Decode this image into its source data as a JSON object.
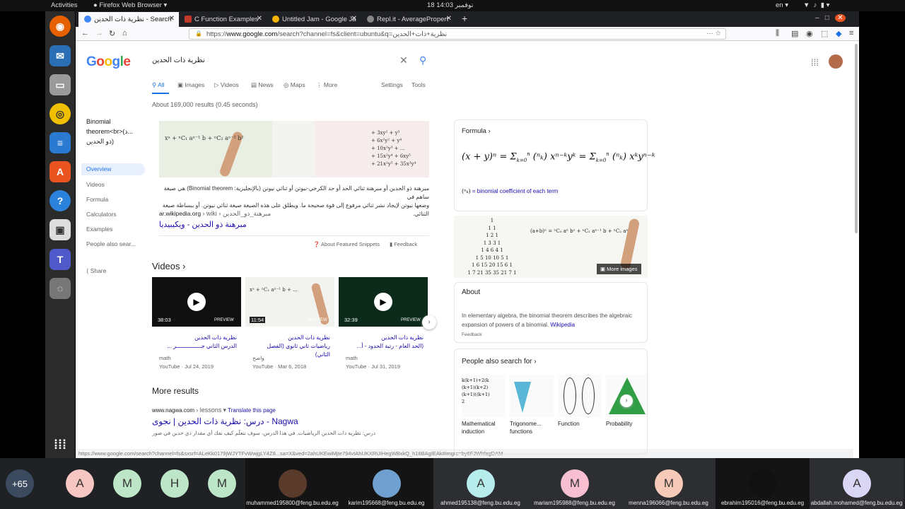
{
  "system": {
    "activities": "Activities",
    "app": "Firefox Web Browser",
    "datetime": "18 نوفمبر  14:03",
    "lang": "en"
  },
  "tabs": [
    {
      "title": "نظرية ذات الحدين - Search"
    },
    {
      "title": "C Function Examples"
    },
    {
      "title": "Untitled Jam - Google Ja"
    },
    {
      "title": "Repl.it - AveragePropert"
    }
  ],
  "url": {
    "prefix": "https://",
    "domain": "www.google.com",
    "path": "/search?channel=fs&client=ubuntu&q=نظرية+ذات+الحدين"
  },
  "search": {
    "logo": "Google",
    "query": "نظرية ذات الحدين"
  },
  "filters": [
    {
      "label": "All",
      "active": true
    },
    {
      "label": "Images"
    },
    {
      "label": "Videos"
    },
    {
      "label": "News"
    },
    {
      "label": "Maps"
    },
    {
      "label": "More"
    }
  ],
  "tools": {
    "settings": "Settings",
    "tools": "Tools"
  },
  "results_count": "About 169,000 results (0.45 seconds)",
  "side_nav": {
    "title": "Binomial theorem<br>(ذ...ذو الحدين)",
    "title1": "Binomial",
    "title2": "theorem<br>(ذ...",
    "title3": "ذو الحدين)",
    "items": [
      "Overview",
      "Videos",
      "Formula",
      "Calculators",
      "Examples",
      "People also sear..."
    ],
    "share": "Share"
  },
  "snippet": {
    "text1": "مبرهنة ذو الحدين أو مبرهنة ثنائي الحد أو حد الكرخي-نيوتن أو ثنائي نيوتن (بالإنجليزية: Binomial theorem) هي صيغة ساهم في",
    "text2": "وضعها نيوتن لإيجاد نشر ثنائي مرفوع إلى قوة صحيحة ما. ويطلق على هذه الصيغة صيغة ثنائي نيوتن. أو ببساطة صيغة الثنائي.",
    "source": "ar.wikipedia.org",
    "crumb": "› wiki › مبرهنة_ذو_الحدين",
    "link": "مبرهنة ذو الحدين - ويكيبيديا",
    "about": "About Featured Snippets",
    "feedback": "Feedback"
  },
  "videos": {
    "heading": "Videos",
    "items": [
      {
        "duration": "38:03",
        "preview": "PREVIEW",
        "title1": "نظرية ذات الحدين",
        "title2": "الدرس الثاني جـــــــــــــــر ...",
        "channel": "math",
        "source": "YouTube",
        "date": "Jul 24, 2019"
      },
      {
        "duration": "11:54",
        "preview": "PREVIEW",
        "title1": "نظرية ذات الحدين",
        "title2": "رياضيات ثاني ثانوي (الفصل الثاني)",
        "channel": "واضح",
        "source": "YouTube",
        "date": "Mar 6, 2018"
      },
      {
        "duration": "32:39",
        "preview": "PREVIEW",
        "title1": "نظرية ذات الحدين",
        "title2": "(الحد العام - رتبة الحدود - أ...",
        "channel": "math",
        "source": "YouTube",
        "date": "Jul 31, 2019"
      }
    ]
  },
  "more_results": {
    "heading": "More results",
    "source": "www.nagwa.com",
    "crumb": "› lessons",
    "translate": "Translate this page",
    "title": "درس: نظرية ذات الحدين | نجوى - Nagwa",
    "snippet": "درس: نظرية ذات الحدين الرياضيات. في هذا الدرس، سوف نتعلَّم كيف نفك أي مقدار ذي حدين في صورة: (أ+ب)^ن."
  },
  "status_url": "https://www.google.com/search?channel=fs&sxsrf=ALeKk0179jWJYTFvWwjgLY4Z8...sa=X&ved=2ahUKEwiMjte794vtAhUKXRUIHegWBxkQ_h16BAgIEAk#imgrc=by6FJWhfagDAM",
  "knowledge_panel": {
    "formula_label": "Formula",
    "formula_caption": "= binomial coefficient of each term",
    "more_images": "More images",
    "about_heading": "About",
    "about_text": "In elementary algebra, the binomial theorem describes the algebraic expansion of powers of a binomial.",
    "about_link": "Wikipedia",
    "about_feedback": "Feedback",
    "people_heading": "People also search for",
    "people": [
      "Mathematical induction",
      "Trigonome... functions",
      "Function",
      "Probability"
    ]
  },
  "participants": [
    {
      "label": "+65",
      "name": "",
      "color": "#3c4a5f"
    },
    {
      "label": "A",
      "name": "",
      "color": "#f6c7c2"
    },
    {
      "label": "M",
      "name": "",
      "color": "#bde5c8"
    },
    {
      "label": "H",
      "name": "",
      "color": "#bde5c8"
    },
    {
      "label": "M",
      "name": "",
      "color": "#bde5c8"
    },
    {
      "label": "",
      "name": "muhammed195800@feng.bu.edu.eg",
      "color": "#5a3a2a"
    },
    {
      "label": "",
      "name": "karim195668@feng.bu.edu.eg",
      "color": "#6fa0d0"
    },
    {
      "label": "A",
      "name": "ahmed195138@feng.bu.edu.eg",
      "color": "#b7ecec"
    },
    {
      "label": "M",
      "name": "mariam195988@feng.bu.edu.eg",
      "color": "#f7bfcf"
    },
    {
      "label": "M",
      "name": "menna196066@feng.bu.edu.eg",
      "color": "#f6c9b9"
    },
    {
      "label": "",
      "name": "ebrahim195016@feng.bu.edu.eg",
      "color": "#111111"
    },
    {
      "label": "A",
      "name": "abdallah.mohamed@feng.bu.edu.eg",
      "color": "#dad7f5"
    }
  ]
}
